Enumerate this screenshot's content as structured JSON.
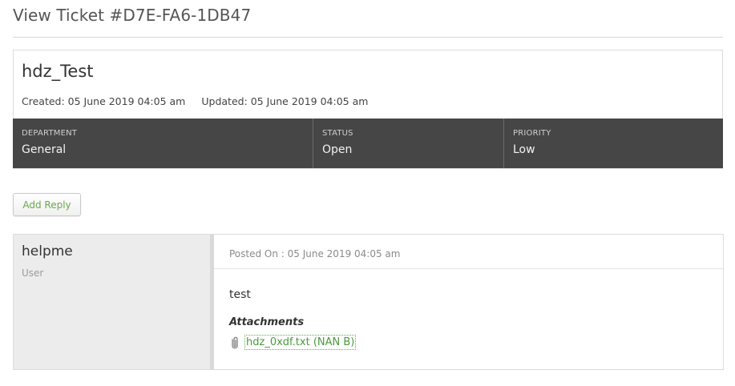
{
  "page": {
    "title": "View Ticket #D7E-FA6-1DB47"
  },
  "ticket": {
    "subject": "hdz_Test",
    "created": "Created: 05 June 2019 04:05 am",
    "updated": "Updated: 05 June 2019 04:05 am",
    "department_label": "DEPARTMENT",
    "department_value": "General",
    "status_label": "STATUS",
    "status_value": "Open",
    "priority_label": "PRIORITY",
    "priority_value": "Low"
  },
  "actions": {
    "add_reply_label": "Add Reply"
  },
  "reply": {
    "user_name": "helpme",
    "user_role": "User",
    "posted_on": "Posted On : 05 June 2019 04:05 am",
    "body": "test",
    "attachments_title": "Attachments",
    "attachment_name": "hdz_0xdf.txt (NAN B)",
    "attachment_icon": "paperclip-icon"
  },
  "colors": {
    "info_bar_bg": "#464646",
    "link_green": "#4a9a3a",
    "user_panel_bg": "#ececec"
  }
}
